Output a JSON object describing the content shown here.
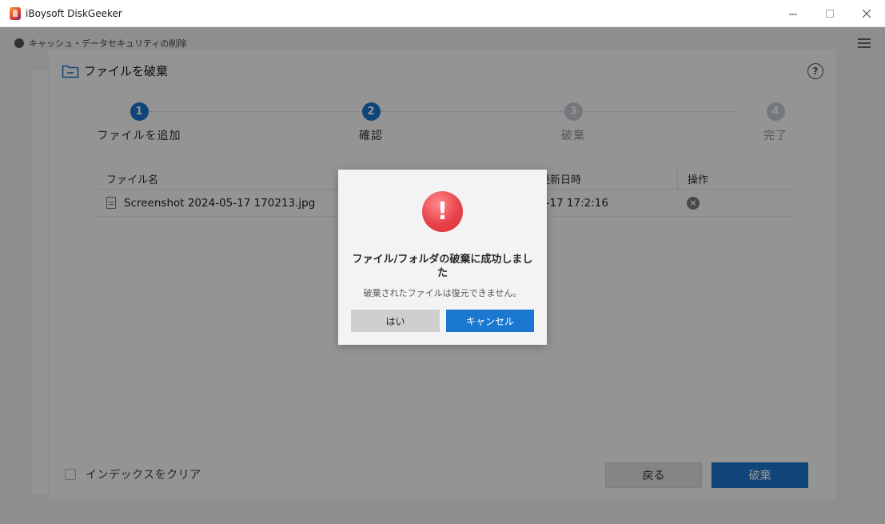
{
  "window": {
    "title": "iBoysoft DiskGeeker",
    "controls": {
      "minimize_icon": "minimize-icon",
      "maximize_icon": "maximize-icon",
      "close_icon": "close-icon"
    }
  },
  "app": {
    "breadcrumb": "キャッシュ・データセキュリティの削除"
  },
  "panel": {
    "title": "ファイルを破棄",
    "help_glyph": "?",
    "steps": [
      {
        "num": "1",
        "label": "ファイルを追加",
        "state": "active"
      },
      {
        "num": "2",
        "label": "確認",
        "state": "active"
      },
      {
        "num": "3",
        "label": "破棄",
        "state": "pending"
      },
      {
        "num": "4",
        "label": "完了",
        "state": "pending"
      }
    ],
    "table": {
      "columns": [
        "ファイル名",
        "更新日時",
        "操作"
      ],
      "rows": [
        {
          "name": "Screenshot 2024-05-17 170213.jpg",
          "modified": "5-17 17:2:16"
        }
      ]
    },
    "clear_index_label": "インデックスをクリア",
    "back_label": "戻る",
    "shred_label": "破棄"
  },
  "dialog": {
    "icon": "alert-icon",
    "icon_glyph": "!",
    "title": "ファイル/フォルダの破棄に成功しました",
    "message": "破棄されたファイルは復元できません。",
    "yes_label": "はい",
    "cancel_label": "キャンセル"
  },
  "colors": {
    "accent": "#1a78d0",
    "alert": "#e8434a",
    "overlay": "rgba(0,0,0,0.42)"
  }
}
